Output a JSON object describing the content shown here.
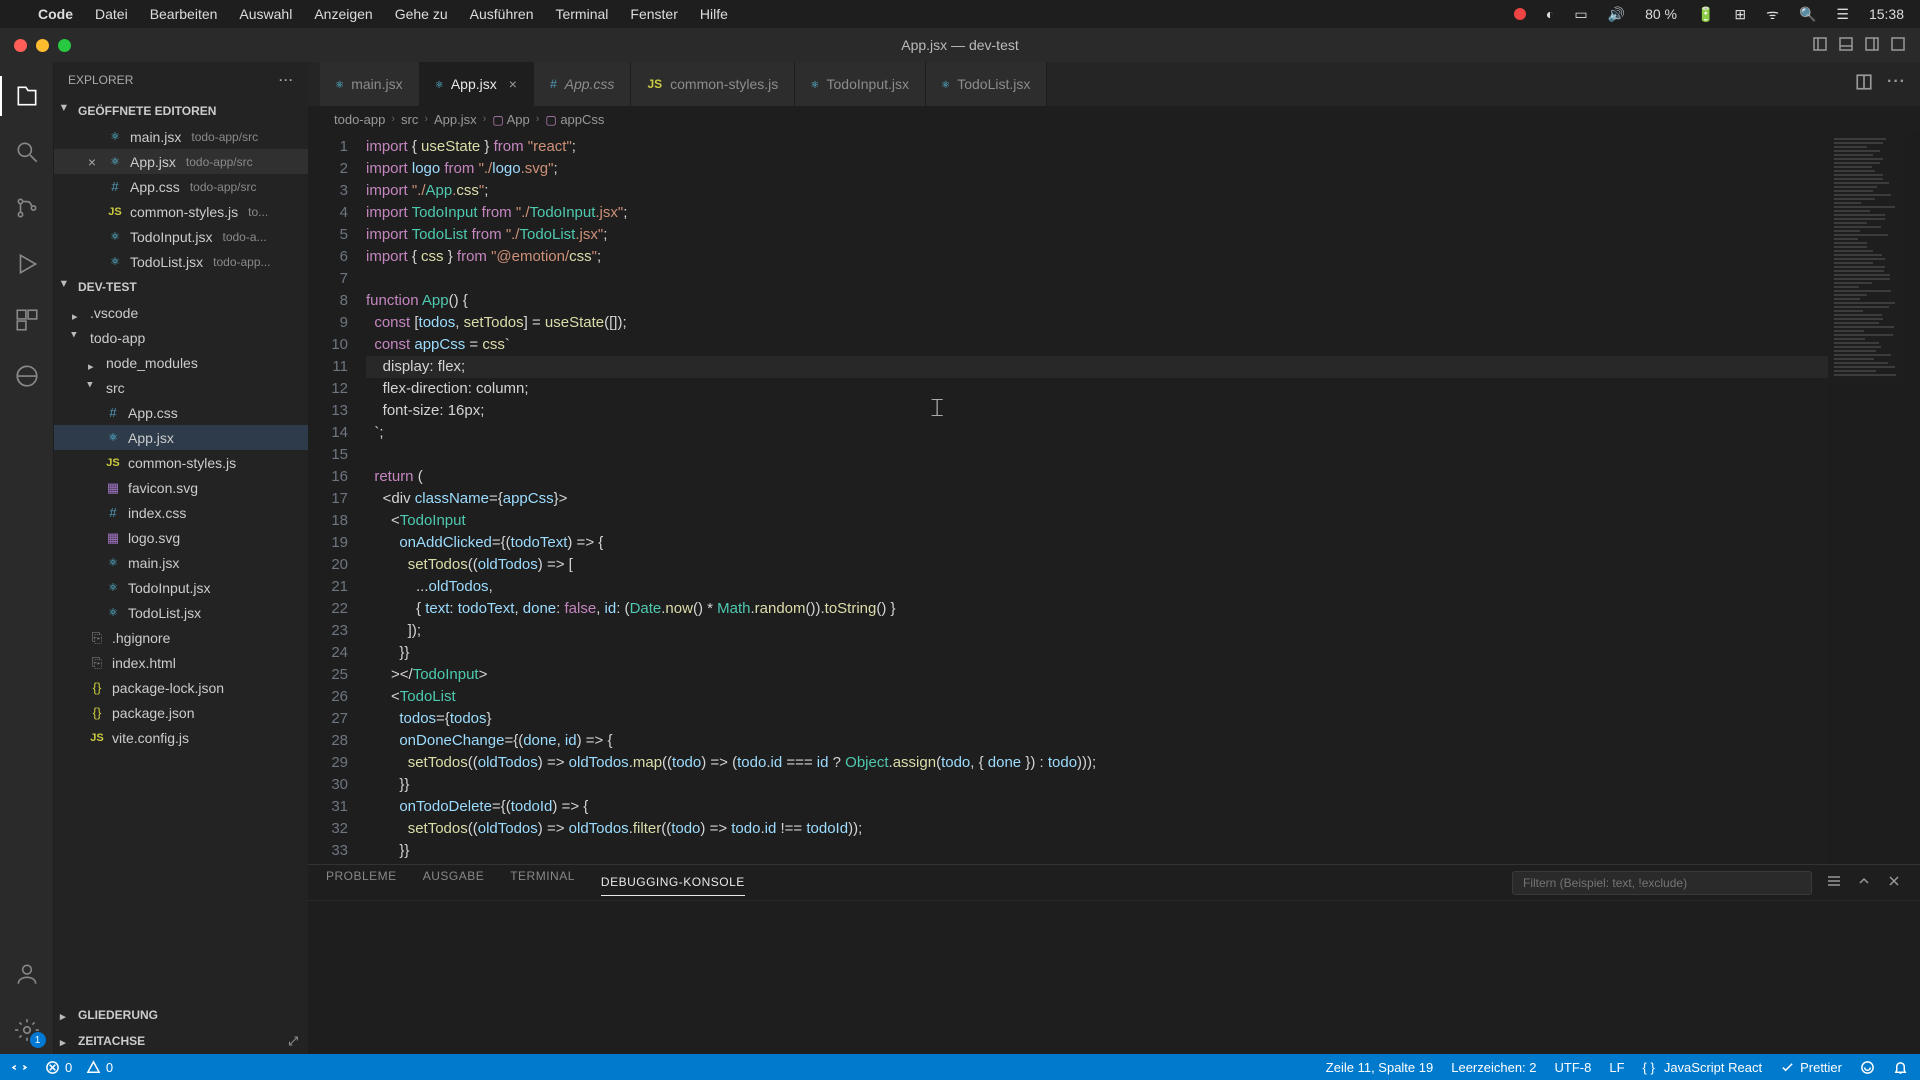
{
  "menubar": {
    "apple": "",
    "app": "Code",
    "items": [
      "Datei",
      "Bearbeiten",
      "Auswahl",
      "Anzeigen",
      "Gehe zu",
      "Ausführen",
      "Terminal",
      "Fenster",
      "Hilfe"
    ],
    "battery": "80 %",
    "time": "15:38"
  },
  "window": {
    "title": "App.jsx — dev-test"
  },
  "sidebar": {
    "title": "EXPLORER",
    "open_editors_label": "GEÖFFNETE EDITOREN",
    "open_editors": [
      {
        "icon": "react",
        "name": "main.jsx",
        "detail": "todo-app/src"
      },
      {
        "icon": "react",
        "name": "App.jsx",
        "detail": "todo-app/src",
        "active": true,
        "closable": true
      },
      {
        "icon": "css",
        "name": "App.css",
        "detail": "todo-app/src"
      },
      {
        "icon": "js",
        "name": "common-styles.js",
        "detail": "to..."
      },
      {
        "icon": "react",
        "name": "TodoInput.jsx",
        "detail": "todo-a..."
      },
      {
        "icon": "react",
        "name": "TodoList.jsx",
        "detail": "todo-app..."
      }
    ],
    "workspace_label": "DEV-TEST",
    "tree": [
      {
        "kind": "folder",
        "name": ".vscode",
        "depth": 0,
        "open": false
      },
      {
        "kind": "folder",
        "name": "todo-app",
        "depth": 0,
        "open": true
      },
      {
        "kind": "folder",
        "name": "node_modules",
        "depth": 1,
        "open": false
      },
      {
        "kind": "folder",
        "name": "src",
        "depth": 1,
        "open": true
      },
      {
        "kind": "file",
        "icon": "css",
        "name": "App.css",
        "depth": 2
      },
      {
        "kind": "file",
        "icon": "react",
        "name": "App.jsx",
        "depth": 2,
        "selected": true
      },
      {
        "kind": "file",
        "icon": "js",
        "name": "common-styles.js",
        "depth": 2
      },
      {
        "kind": "file",
        "icon": "svg",
        "name": "favicon.svg",
        "depth": 2
      },
      {
        "kind": "file",
        "icon": "css",
        "name": "index.css",
        "depth": 2
      },
      {
        "kind": "file",
        "icon": "svg",
        "name": "logo.svg",
        "depth": 2
      },
      {
        "kind": "file",
        "icon": "react",
        "name": "main.jsx",
        "depth": 2
      },
      {
        "kind": "file",
        "icon": "react",
        "name": "TodoInput.jsx",
        "depth": 2
      },
      {
        "kind": "file",
        "icon": "react",
        "name": "TodoList.jsx",
        "depth": 2
      },
      {
        "kind": "file",
        "icon": "gen",
        "name": ".hgignore",
        "depth": 1
      },
      {
        "kind": "file",
        "icon": "gen",
        "name": "index.html",
        "depth": 1
      },
      {
        "kind": "file",
        "icon": "json",
        "name": "package-lock.json",
        "depth": 1
      },
      {
        "kind": "file",
        "icon": "json",
        "name": "package.json",
        "depth": 1
      },
      {
        "kind": "file",
        "icon": "js",
        "name": "vite.config.js",
        "depth": 1
      }
    ],
    "outline_label": "GLIEDERUNG",
    "timeline_label": "ZEITACHSE"
  },
  "tabs": [
    {
      "icon": "react",
      "label": "main.jsx"
    },
    {
      "icon": "react",
      "label": "App.jsx",
      "active": true,
      "close": true
    },
    {
      "icon": "css",
      "label": "App.css",
      "italic": true
    },
    {
      "icon": "js",
      "label": "common-styles.js"
    },
    {
      "icon": "react",
      "label": "TodoInput.jsx"
    },
    {
      "icon": "react",
      "label": "TodoList.jsx"
    }
  ],
  "breadcrumb": [
    "todo-app",
    "src",
    "App.jsx",
    "App",
    "appCss"
  ],
  "code": {
    "start_line": 1,
    "current_line": 11,
    "lines": [
      "import { useState } from \"react\";",
      "import logo from \"./logo.svg\";",
      "import \"./App.css\";",
      "import TodoInput from \"./TodoInput.jsx\";",
      "import TodoList from \"./TodoList.jsx\";",
      "import { css } from \"@emotion/css\";",
      "",
      "function App() {",
      "  const [todos, setTodos] = useState([]);",
      "  const appCss = css`",
      "    display: flex;",
      "    flex-direction: column;",
      "    font-size: 16px;",
      "  `;",
      "",
      "  return (",
      "    <div className={appCss}>",
      "      <TodoInput",
      "        onAddClicked={(todoText) => {",
      "          setTodos((oldTodos) => [",
      "            ...oldTodos,",
      "            { text: todoText, done: false, id: (Date.now() * Math.random()).toString() }",
      "          ]);",
      "        }}",
      "      ></TodoInput>",
      "      <TodoList",
      "        todos={todos}",
      "        onDoneChange={(done, id) => {",
      "          setTodos((oldTodos) => oldTodos.map((todo) => (todo.id === id ? Object.assign(todo, { done }) : todo)));",
      "        }}",
      "        onTodoDelete={(todoId) => {",
      "          setTodos((oldTodos) => oldTodos.filter((todo) => todo.id !== todoId));",
      "        }}"
    ]
  },
  "panel": {
    "tabs": [
      "PROBLEME",
      "AUSGABE",
      "TERMINAL",
      "DEBUGGING-KONSOLE"
    ],
    "active_tab": 3,
    "filter_placeholder": "Filtern (Beispiel: text, !exclude)"
  },
  "status": {
    "remote_badge": "1",
    "errors": "0",
    "warnings": "0",
    "cursor": "Zeile 11, Spalte 19",
    "spaces": "Leerzeichen: 2",
    "encoding": "UTF-8",
    "eol": "LF",
    "lang": "JavaScript React",
    "prettier": "Prettier"
  }
}
